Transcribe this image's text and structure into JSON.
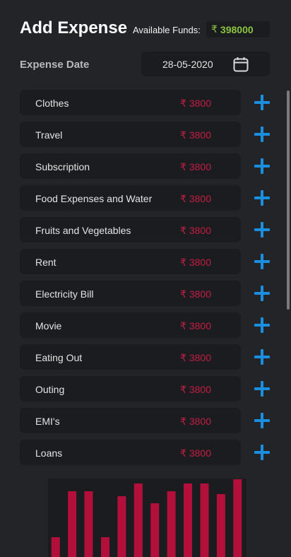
{
  "header": {
    "title": "Add Expense",
    "funds_label": "Available Funds:",
    "currency_symbol": "₹",
    "funds_value": "398000",
    "funds_color": "#8bc53f"
  },
  "date": {
    "label": "Expense Date",
    "value": "28-05-2020",
    "icon": "calendar-icon"
  },
  "expenses": [
    {
      "name": "Clothes",
      "amount": "₹ 3800"
    },
    {
      "name": "Travel",
      "amount": "₹ 3800"
    },
    {
      "name": "Subscription",
      "amount": "₹ 3800"
    },
    {
      "name": "Food Expenses and Water",
      "amount": "₹ 3800"
    },
    {
      "name": "Fruits and Vegetables",
      "amount": "₹ 3800"
    },
    {
      "name": "Rent",
      "amount": "₹ 3800"
    },
    {
      "name": "Electricity Bill",
      "amount": "₹ 3800"
    },
    {
      "name": "Movie",
      "amount": "₹ 3800"
    },
    {
      "name": "Eating Out",
      "amount": "₹ 3800"
    },
    {
      "name": "Outing",
      "amount": "₹ 3800"
    },
    {
      "name": "EMI's",
      "amount": "₹ 3800"
    },
    {
      "name": "Loans",
      "amount": "₹ 3800"
    }
  ],
  "colors": {
    "background": "#232427",
    "card": "#1b1c1f",
    "amount": "#c21e45",
    "add_button": "#1a8fe0",
    "bar": "#b2103a"
  },
  "chart_data": {
    "type": "bar",
    "title": "",
    "xlabel": "",
    "ylabel": "",
    "categories": [],
    "values": [
      28,
      93,
      93,
      28,
      86,
      104,
      76,
      93,
      104,
      104,
      89,
      110
    ],
    "ylim": [
      0,
      111
    ],
    "grid": false,
    "legend": "none"
  }
}
